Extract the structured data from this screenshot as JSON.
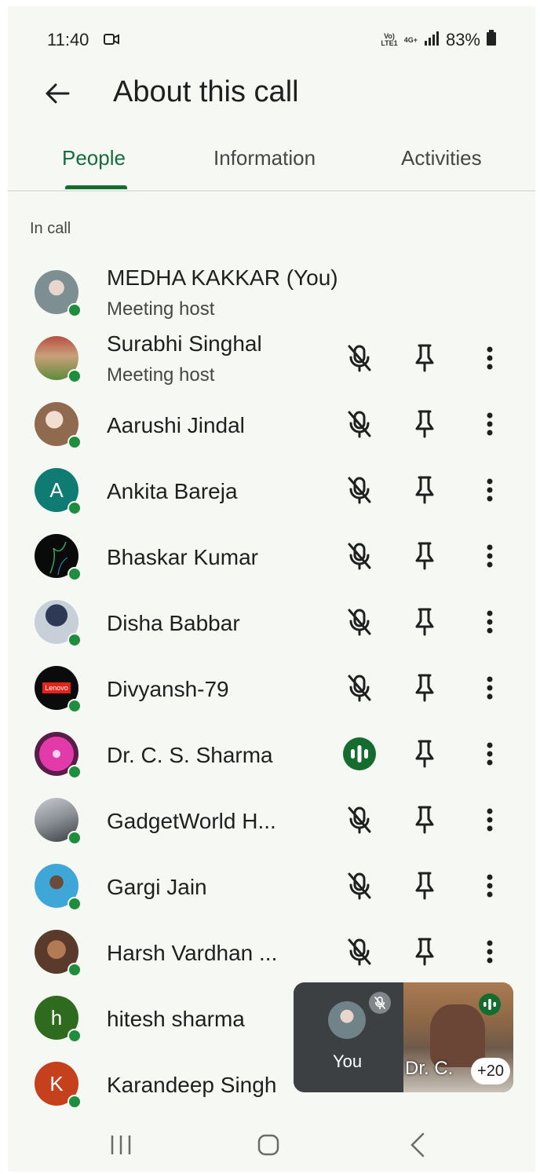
{
  "status_bar": {
    "time": "11:40",
    "battery": "83%",
    "network_top": "Vo)",
    "network_bottom": "LTE1",
    "gen": "4G+"
  },
  "header": {
    "title": "About this call"
  },
  "tabs": [
    {
      "label": "People",
      "active": true
    },
    {
      "label": "Information",
      "active": false
    },
    {
      "label": "Activities",
      "active": false
    }
  ],
  "section": {
    "label": "In call"
  },
  "participants": [
    {
      "name": "MEDHA KAKKAR (You)",
      "subtitle": "Meeting host"
    },
    {
      "name": "Surabhi Singhal",
      "subtitle": "Meeting host"
    },
    {
      "name": "Aarushi Jindal"
    },
    {
      "name": "Ankita Bareja",
      "initial": "A"
    },
    {
      "name": "Bhaskar Kumar"
    },
    {
      "name": "Disha Babbar"
    },
    {
      "name": "Divyansh-79",
      "avatar_text": "Lenovo"
    },
    {
      "name": "Dr. C. S. Sharma"
    },
    {
      "name": "GadgetWorld H..."
    },
    {
      "name": "Gargi Jain"
    },
    {
      "name": "Harsh Vardhan ..."
    },
    {
      "name": "hitesh sharma",
      "initial": "h"
    },
    {
      "name": "Karandeep Singh",
      "initial": "K"
    }
  ],
  "self_view": {
    "you_label": "You",
    "other_label": "Dr. C.",
    "more_count": "+20"
  },
  "colors": {
    "accent": "#146c2e",
    "online": "#1e8e3e",
    "background": "#f6f8f4"
  }
}
